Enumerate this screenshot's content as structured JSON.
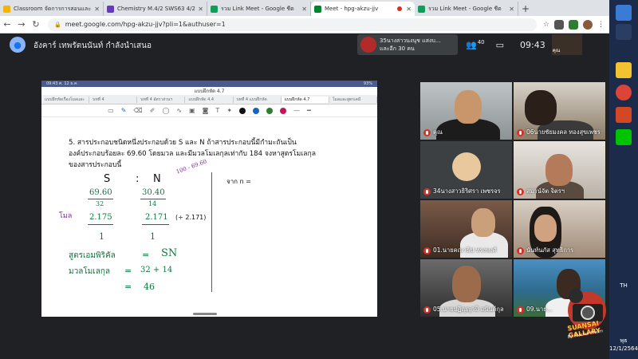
{
  "browser": {
    "tabs": [
      {
        "title": "Classroom จัดการการสอนและ",
        "color": "#f5b400",
        "active": false
      },
      {
        "title": "Chemistry M.4/2 SWS63 4/2",
        "color": "#673ab7",
        "active": false
      },
      {
        "title": "รวม Link Meet - Google ชีต",
        "color": "#0f9d58",
        "active": false
      },
      {
        "title": "Meet - hpg-akzu-jjv",
        "color": "#00832d",
        "active": true
      },
      {
        "title": "รวม Link Meet - Google ชีต",
        "color": "#0f9d58",
        "active": false
      }
    ],
    "new_tab": "+",
    "url": "meet.google.com/hpg-akzu-jjv?pli=1&authuser=1"
  },
  "meet": {
    "presenter_label": "อังคาร์ เทพรัตนนันท์ กำลังนำเสนอ",
    "notification_line1": "35นางสาวนงนุช แสงบ...",
    "notification_line2": "และอีก 30 คน",
    "participant_count": "40",
    "time": "09:43",
    "self_label": "คุณ"
  },
  "presentation": {
    "status_left": "09:43  ศ. 12 ธ.ค.",
    "status_right": "93%",
    "doc_title": "แบบฝึกหัด 4.7",
    "tabs": [
      "แบบฝึกหัดเรื่องโมลและ",
      "บทที่ 4",
      "บทที่ 4 อัตราส่วนฯ",
      "แบบฝึกหัด 4.4",
      "บทที่ 4 แบบฝึกหัด",
      "แบบฝึกหัด 4.7",
      "โมลและสูตรเคมี"
    ],
    "question_line1": "5. สารประกอบชนิดหนึ่งประกอบด้วย S และ N ถ้าสารประกอบนี้มีกำมะถันเป็น",
    "question_line2": "องค์ประกอบร้อยละ 69.60 โดยมวล และมีมวลโมเลกุลเท่ากับ 184 จงหาสูตรโมเลกุล",
    "question_line3": "ของสารประกอบนี้",
    "hw_S": "S",
    "hw_colon": ":",
    "hw_N": "N",
    "hw_annot": "100 - 69.60",
    "hw_s_num": "69.60",
    "hw_s_den": "32",
    "hw_n_num": "30.40",
    "hw_n_den": "14",
    "hw_mol": "โมล",
    "hw_s_mol": "2.175",
    "hw_n_mol": "2.171",
    "hw_div": "(÷ 2.171)",
    "hw_one_a": "1",
    "hw_one_b": "1",
    "hw_empirical": "สูตรเอมพิริคัล",
    "hw_eq": "=",
    "hw_formula": "SN",
    "hw_mass_label": "มวลโมเลกุล",
    "hw_sum": "32 + 14",
    "hw_total": "46",
    "hw_right": "จาก  n  ="
  },
  "participants": [
    {
      "name": "คุณ"
    },
    {
      "name": "06นายชัยมงคล ทองสุขเพชร"
    },
    {
      "name": "34นางสาวธิริศรา เพชรจร"
    },
    {
      "name": "สมาน์จัต จิตรฯ"
    },
    {
      "name": "01.นายคณาธิป ทรงพงศ์"
    },
    {
      "name": "นันท์นภัส สุทธิการ"
    },
    {
      "name": "05.นายปฏิญญามิ อนันต์กุล"
    },
    {
      "name": "09.นาย..."
    }
  ],
  "taskbar": {
    "language": "TH",
    "day": "พุธ",
    "date": "12/1/2564"
  },
  "watermark": {
    "title": "SUANSAI GALLARY",
    "subtitle": "By Teacher Pleum"
  }
}
